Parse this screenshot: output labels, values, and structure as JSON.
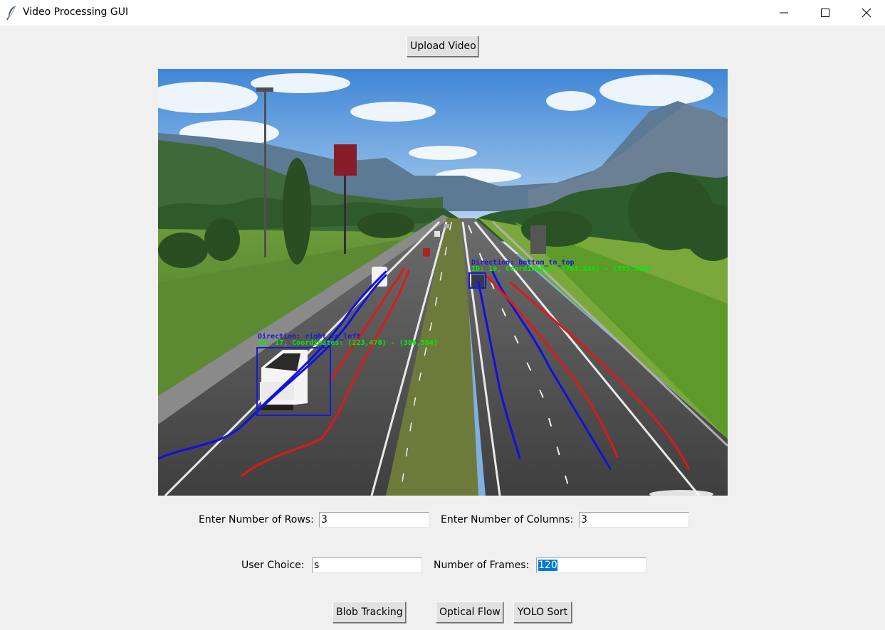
{
  "window": {
    "title": "Video Processing GUI"
  },
  "upload_button": {
    "label": "Upload Video"
  },
  "video": {
    "overlays": {
      "vehicle_left": {
        "direction": "Direction: right_to_left",
        "coords": "ID: 17, Coordinates: (223,470) - (386,584)"
      },
      "vehicle_right": {
        "direction": "Direction: bottom_to_top",
        "coords": "ID: 10, Coordinates: (703,344) - (735,368)"
      }
    },
    "colors": {
      "trajectory_blue": "#1010e0",
      "trajectory_red": "#e01818",
      "box": "#1a1ad0",
      "coords_text": "#00ee00"
    }
  },
  "form": {
    "rows": {
      "label": "Enter Number of Rows:",
      "value": "3"
    },
    "columns": {
      "label": "Enter Number of Columns:",
      "value": "3"
    },
    "user_choice": {
      "label": "User Choice:",
      "value": "s"
    },
    "frames": {
      "label": "Number of Frames:",
      "value": "120"
    }
  },
  "buttons": {
    "blob": "Blob Tracking",
    "optical_flow": "Optical Flow",
    "yolo_sort": "YOLO Sort"
  }
}
